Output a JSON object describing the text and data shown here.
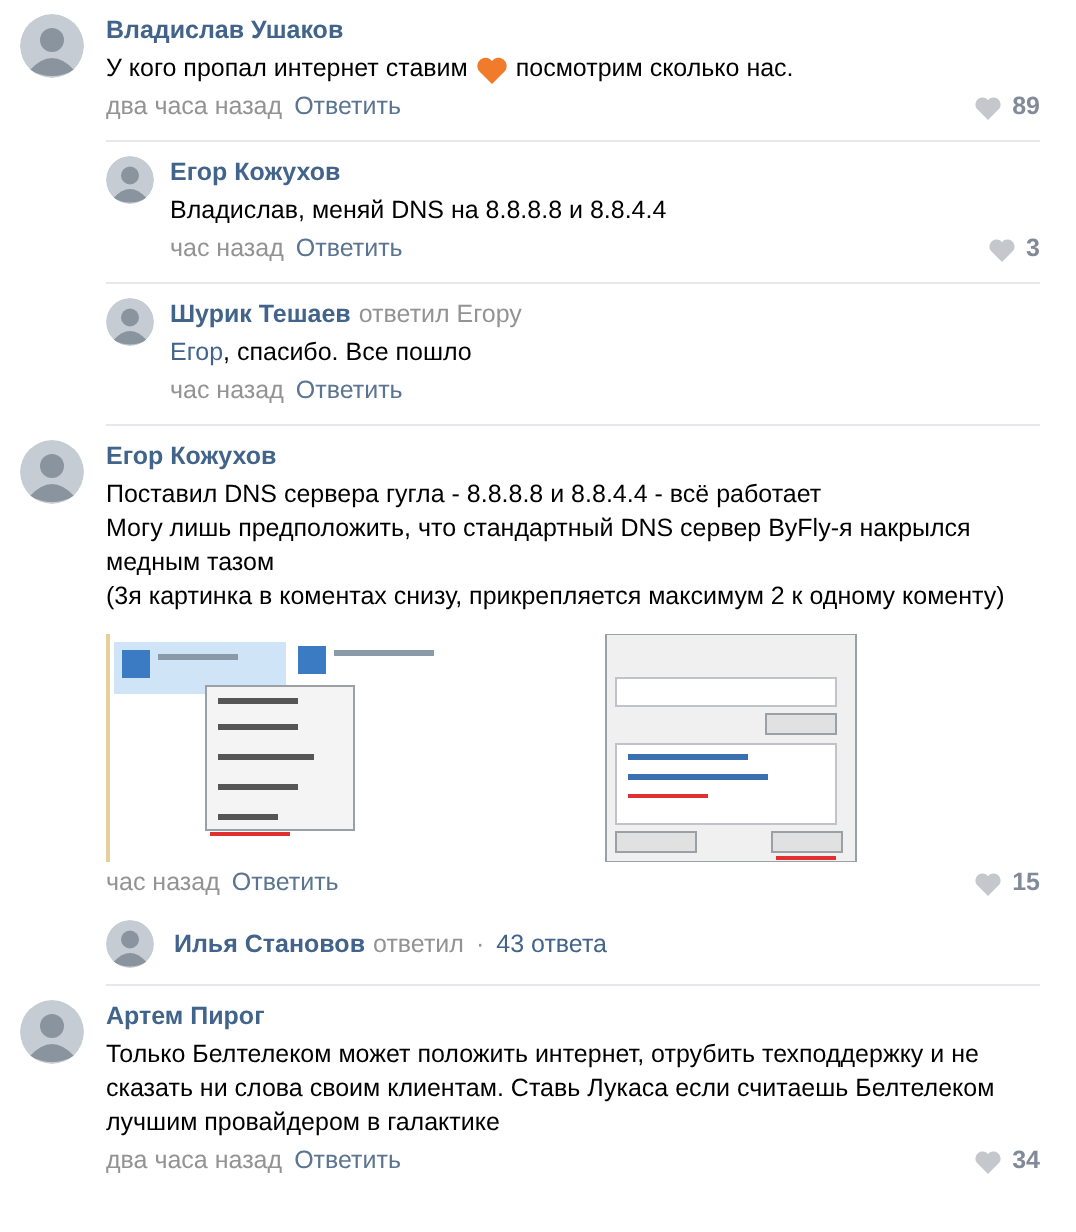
{
  "comments": [
    {
      "author": "Владислав Ушаков",
      "text_parts": [
        {
          "kind": "text",
          "text": "У кого пропал интернет ставим"
        },
        {
          "kind": "heart"
        },
        {
          "kind": "text",
          "text": "посмотрим сколько нас."
        }
      ],
      "time": "два часа назад",
      "reply": "Ответить",
      "likes": "89",
      "replies": [
        {
          "author": "Егор Кожухов",
          "text_parts": [
            {
              "kind": "text",
              "text": "Владислав, меняй DNS на 8.8.8.8 и 8.8.4.4"
            }
          ],
          "time": "час назад",
          "reply": "Ответить",
          "likes": "3"
        },
        {
          "author": "Шурик Тешаев",
          "replied_to": "ответил Егору",
          "text_parts": [
            {
              "kind": "mention",
              "text": "Егор"
            },
            {
              "kind": "text",
              "text": ", спасибо. Все пошло"
            }
          ],
          "time": "час назад",
          "reply": "Ответить"
        }
      ]
    },
    {
      "author": "Егор Кожухов",
      "lines": [
        "Поставил DNS сервера гугла - 8.8.8.8 и 8.8.4.4 - всё работает",
        "Могу лишь предположить, что стандартный DNS сервер ByFly-я накрылся медным тазом",
        "(3я картинка в коментах снизу, прикрепляется максимум 2 к одному коменту)"
      ],
      "time": "час назад",
      "reply": "Ответить",
      "likes": "15",
      "more_replies": {
        "author": "Илья Становов",
        "action": "ответил",
        "separator": "·",
        "count": "43 ответа"
      }
    },
    {
      "author": "Артем Пирог",
      "lines": [
        "Только Белтелеком может положить интернет, отрубить техподдержку и не сказать ни слова своим клиентам. Ставь Лукаса если считаешь Белтелеком лучшим провайдером в галактике"
      ],
      "time": "два часа назад",
      "reply": "Ответить",
      "likes": "34"
    }
  ]
}
